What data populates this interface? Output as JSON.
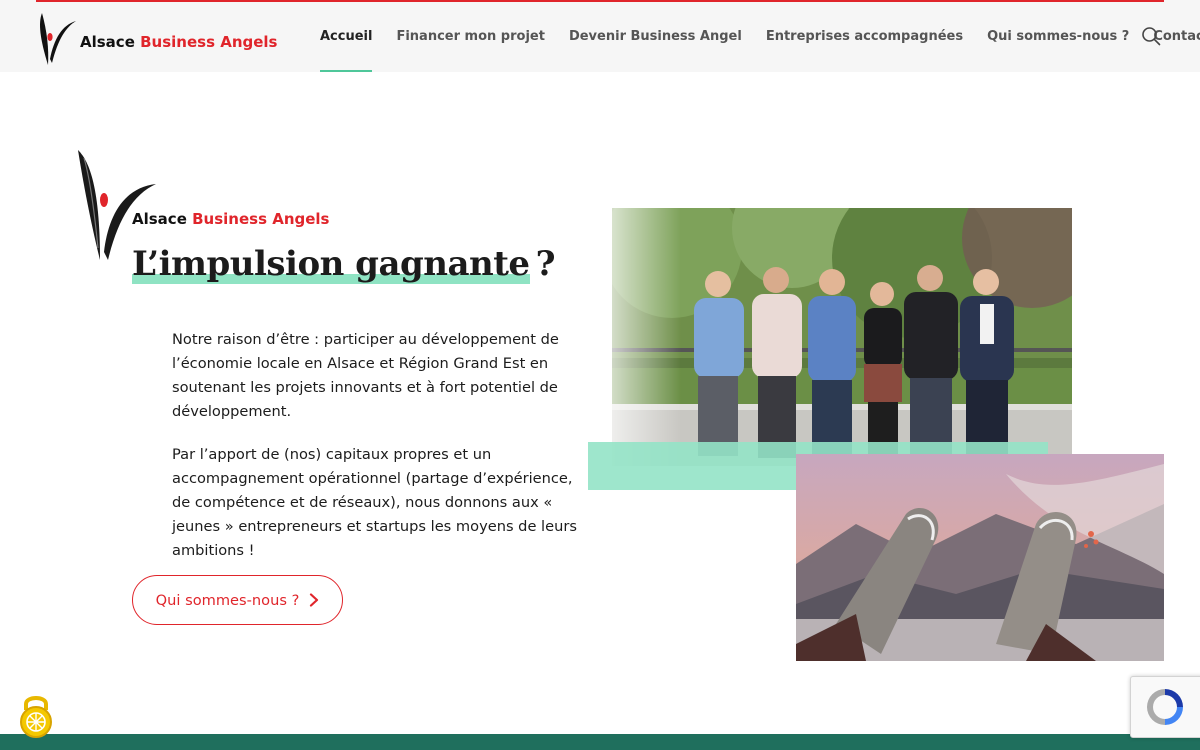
{
  "brand": {
    "name_part1": "Alsace",
    "name_part2": "Business Angels",
    "accent_color": "#e0252b",
    "highlight_color": "#8fe3c3",
    "dark_green": "#1f6f5d"
  },
  "nav": {
    "items": [
      {
        "label": "Accueil",
        "active": true
      },
      {
        "label": "Financer mon projet",
        "active": false
      },
      {
        "label": "Devenir Business Angel",
        "active": false
      },
      {
        "label": "Entreprises accompagnées",
        "active": false
      },
      {
        "label": "Qui sommes-nous ?",
        "active": false
      },
      {
        "label": "Contact",
        "active": false
      }
    ],
    "search_icon": "search-icon"
  },
  "hero": {
    "brand_part1": "Alsace",
    "brand_part2": "Business Angels",
    "title_main": "L’impulsion gagnante",
    "title_suffix": "?",
    "paragraph1": "Notre raison d’être : participer au développement de l’économie locale en Alsace et Région Grand Est en soutenant les projets innovants et à fort potentiel de développement.",
    "paragraph2": "Par l’apport de (nos) capitaux propres et un accompagnement opérationnel (partage d’expérience, de compétence et de réseaux), nous donnons aux « jeunes » entrepreneurs et startups les moyens de leurs ambitions !",
    "cta_label": "Qui sommes-nous ?"
  },
  "widgets": {
    "lock_icon": "cookie-lock-icon",
    "recaptcha_icon": "recaptcha-icon"
  }
}
